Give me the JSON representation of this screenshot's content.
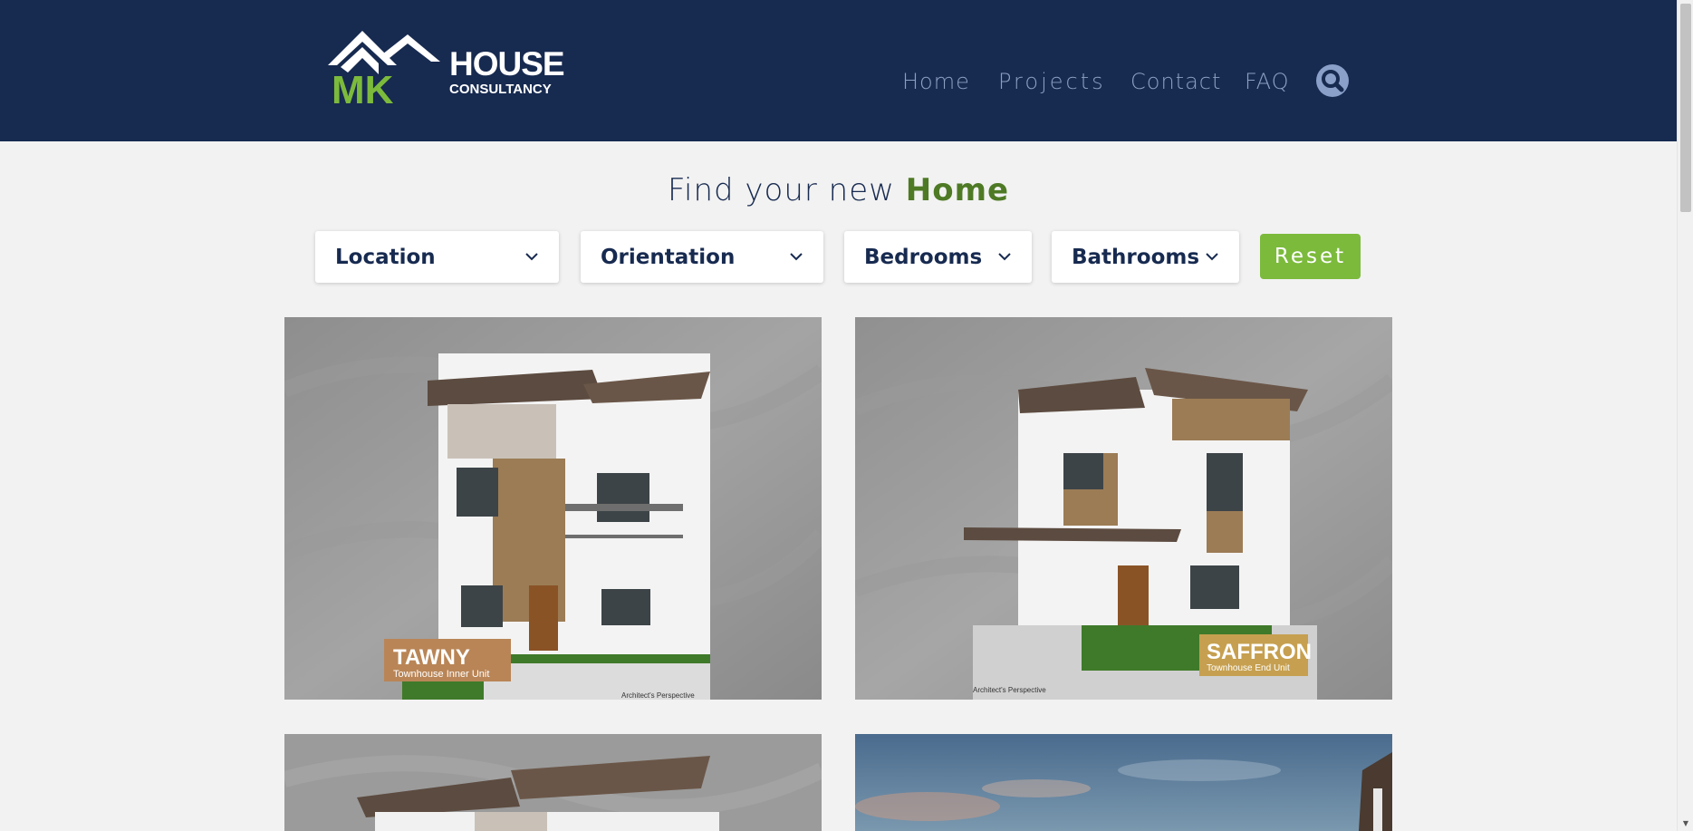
{
  "brand": {
    "line1": "HOUSE",
    "line2": "CONSULTANCY",
    "mark": "MK"
  },
  "nav": {
    "home": "Home",
    "projects": "Projects",
    "contact": "Contact",
    "faq": "FAQ",
    "search_icon": "search-icon"
  },
  "hero": {
    "title_prefix": "Find your new ",
    "title_highlight": "Home"
  },
  "filters": {
    "location": "Location",
    "orientation": "Orientation",
    "bedrooms": "Bedrooms",
    "bathrooms": "Bathrooms",
    "reset": "Reset"
  },
  "listings": [
    {
      "name": "TAWNY",
      "subtitle": "Townhouse Inner Unit",
      "caption": "Architect's Perspective"
    },
    {
      "name": "SAFFRON",
      "subtitle": "Townhouse End Unit",
      "caption": "Architect's Perspective"
    }
  ],
  "colors": {
    "header": "#172a50",
    "accent_green": "#7cba3c",
    "title_green": "#4e7a25",
    "nav_text": "#8ca0c2"
  }
}
